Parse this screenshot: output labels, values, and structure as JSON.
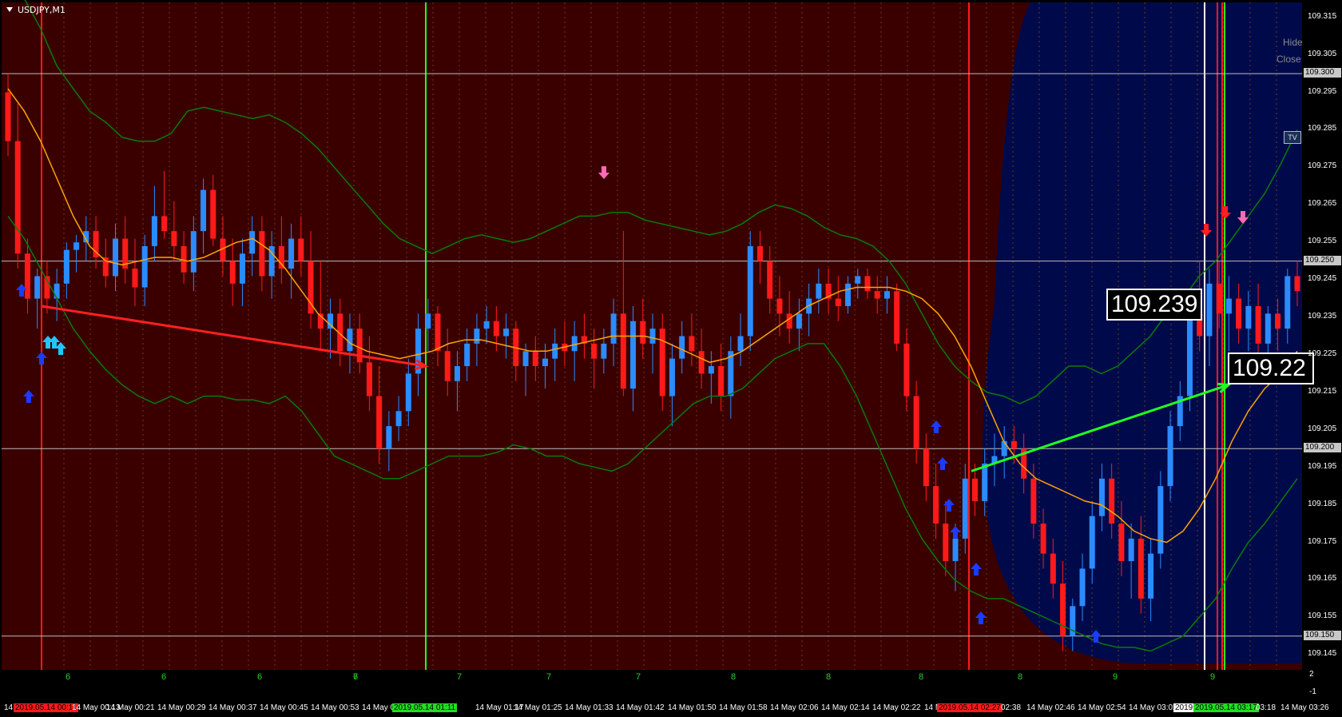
{
  "window": {
    "title": "USDJPY,M1"
  },
  "controls": {
    "hide_label": "Hide",
    "close_label": "Close",
    "tv_label": "TV"
  },
  "colors": {
    "background_red": "#3a0000",
    "background_blue": "#000a4a",
    "bull_candle": "#2a8cff",
    "bear_candle": "#ff1a1a",
    "ma_line": "#ffa500",
    "band_line": "#0a7a0a",
    "arrow_up": "#1a3cff",
    "arrow_up_cyan": "#22c6ff",
    "arrow_down": "#ff6ab4",
    "trend_red": "#ff2020",
    "trend_green": "#22ff22"
  },
  "price_boxes": [
    {
      "name": "price-box-109239",
      "text": "109.239"
    },
    {
      "name": "price-box-10922",
      "text": "109.22"
    }
  ],
  "y_axis": {
    "labels": [
      "109.315",
      "109.305",
      "109.300",
      "109.295",
      "109.285",
      "109.275",
      "109.265",
      "109.255",
      "109.250",
      "109.245",
      "109.235",
      "109.225",
      "109.215",
      "109.205",
      "109.200",
      "109.195",
      "109.185",
      "109.175",
      "109.165",
      "109.155",
      "109.150",
      "109.145"
    ],
    "boxed": [
      "109.300",
      "109.250",
      "109.200",
      "109.150"
    ]
  },
  "x_axis": {
    "labels": [
      {
        "text": "14",
        "style": "plain"
      },
      {
        "text": "2019.05.14 00:11",
        "style": "red"
      },
      {
        "text": "14 May 00:13",
        "style": "plain"
      },
      {
        "text": "14 May 00:21",
        "style": "plain"
      },
      {
        "text": "14 May 00:29",
        "style": "plain"
      },
      {
        "text": "14 May 00:37",
        "style": "plain"
      },
      {
        "text": "14 May 00:45",
        "style": "plain"
      },
      {
        "text": "14 May 00:53",
        "style": "plain"
      },
      {
        "text": "14 May 0",
        "style": "plain"
      },
      {
        "text": "2019.05.14 01:11",
        "style": "green"
      },
      {
        "text": "14 May 01:17",
        "style": "plain"
      },
      {
        "text": "14 May 01:25",
        "style": "plain"
      },
      {
        "text": "14 May 01:33",
        "style": "plain"
      },
      {
        "text": "14 May 01:42",
        "style": "plain"
      },
      {
        "text": "14 May 01:50",
        "style": "plain"
      },
      {
        "text": "14 May 01:58",
        "style": "plain"
      },
      {
        "text": "14 May 02:06",
        "style": "plain"
      },
      {
        "text": "14 May 02:14",
        "style": "plain"
      },
      {
        "text": "14 May 02:22",
        "style": "plain"
      },
      {
        "text": "14 M",
        "style": "plain"
      },
      {
        "text": "2019.05.14 02:27",
        "style": "red"
      },
      {
        "text": "02:38",
        "style": "plain"
      },
      {
        "text": "14 May 02:46",
        "style": "plain"
      },
      {
        "text": "14 May 02:54",
        "style": "plain"
      },
      {
        "text": "14 May 03:02",
        "style": "plain"
      },
      {
        "text": "2019",
        "style": "white"
      },
      {
        "text": "2019.05.14 03:17",
        "style": "green"
      },
      {
        "text": "03:18",
        "style": "plain"
      },
      {
        "text": "14 May 03:26",
        "style": "plain"
      }
    ]
  },
  "bar_numbers": [
    "6",
    "6",
    "6",
    "6",
    "7",
    "7",
    "7",
    "7",
    "8",
    "8",
    "8",
    "8",
    "9",
    "9"
  ],
  "right_markers": [
    "2",
    "-1"
  ],
  "chart_data": {
    "type": "candlestick",
    "title": "USDJPY,M1",
    "ylim": [
      109.141,
      109.319
    ],
    "candles_ohlc": [
      [
        109.295,
        109.3,
        109.278,
        109.282
      ],
      [
        109.282,
        109.292,
        109.248,
        109.252
      ],
      [
        109.252,
        109.256,
        109.236,
        109.24
      ],
      [
        109.24,
        109.248,
        109.232,
        109.246
      ],
      [
        109.246,
        109.25,
        109.236,
        109.24
      ],
      [
        109.24,
        109.248,
        109.234,
        109.244
      ],
      [
        109.244,
        109.255,
        109.24,
        109.253
      ],
      [
        109.253,
        109.257,
        109.247,
        109.255
      ],
      [
        109.255,
        109.262,
        109.25,
        109.258
      ],
      [
        109.258,
        109.262,
        109.248,
        109.251
      ],
      [
        109.251,
        109.256,
        109.243,
        109.246
      ],
      [
        109.246,
        109.26,
        109.242,
        109.256
      ],
      [
        109.256,
        109.262,
        109.244,
        109.248
      ],
      [
        109.248,
        109.256,
        109.238,
        109.243
      ],
      [
        109.243,
        109.257,
        109.238,
        109.254
      ],
      [
        109.254,
        109.27,
        109.25,
        109.262
      ],
      [
        109.262,
        109.274,
        109.256,
        109.258
      ],
      [
        109.258,
        109.266,
        109.25,
        109.254
      ],
      [
        109.254,
        109.258,
        109.244,
        109.247
      ],
      [
        109.247,
        109.262,
        109.242,
        109.258
      ],
      [
        109.258,
        109.272,
        109.252,
        109.269
      ],
      [
        109.269,
        109.273,
        109.254,
        109.256
      ],
      [
        109.256,
        109.262,
        109.246,
        109.25
      ],
      [
        109.25,
        109.256,
        109.238,
        109.244
      ],
      [
        109.244,
        109.256,
        109.238,
        109.252
      ],
      [
        109.252,
        109.262,
        109.246,
        109.258
      ],
      [
        109.258,
        109.262,
        109.242,
        109.246
      ],
      [
        109.246,
        109.258,
        109.24,
        109.254
      ],
      [
        109.254,
        109.262,
        109.244,
        109.248
      ],
      [
        109.248,
        109.26,
        109.24,
        109.256
      ],
      [
        109.256,
        109.262,
        109.246,
        109.25
      ],
      [
        109.25,
        109.258,
        109.232,
        109.236
      ],
      [
        109.236,
        109.25,
        109.226,
        109.232
      ],
      [
        109.232,
        109.24,
        109.224,
        109.236
      ],
      [
        109.236,
        109.24,
        109.222,
        109.226
      ],
      [
        109.226,
        109.236,
        109.22,
        109.232
      ],
      [
        109.232,
        109.236,
        109.22,
        109.223
      ],
      [
        109.223,
        109.23,
        109.21,
        109.214
      ],
      [
        109.214,
        109.222,
        109.196,
        109.2
      ],
      [
        109.2,
        109.21,
        109.194,
        109.206
      ],
      [
        109.206,
        109.214,
        109.202,
        109.21
      ],
      [
        109.21,
        109.224,
        109.206,
        109.22
      ],
      [
        109.22,
        109.236,
        109.214,
        109.232
      ],
      [
        109.232,
        109.24,
        109.226,
        109.236
      ],
      [
        109.236,
        109.238,
        109.222,
        109.226
      ],
      [
        109.226,
        109.232,
        109.214,
        109.218
      ],
      [
        109.218,
        109.226,
        109.21,
        109.222
      ],
      [
        109.222,
        109.232,
        109.218,
        109.228
      ],
      [
        109.228,
        109.236,
        109.222,
        109.232
      ],
      [
        109.232,
        109.238,
        109.228,
        109.234
      ],
      [
        109.234,
        109.238,
        109.226,
        109.23
      ],
      [
        109.23,
        109.236,
        109.224,
        109.232
      ],
      [
        109.232,
        109.234,
        109.218,
        109.222
      ],
      [
        109.222,
        109.228,
        109.214,
        109.226
      ],
      [
        109.226,
        109.23,
        109.218,
        109.222
      ],
      [
        109.222,
        109.228,
        109.216,
        109.224
      ],
      [
        109.224,
        109.232,
        109.218,
        109.228
      ],
      [
        109.228,
        109.234,
        109.222,
        109.226
      ],
      [
        109.226,
        109.234,
        109.218,
        109.23
      ],
      [
        109.23,
        109.236,
        109.224,
        109.228
      ],
      [
        109.228,
        109.232,
        109.216,
        109.224
      ],
      [
        109.224,
        109.232,
        109.22,
        109.228
      ],
      [
        109.228,
        109.24,
        109.222,
        109.236
      ],
      [
        109.236,
        109.258,
        109.214,
        109.216
      ],
      [
        109.216,
        109.238,
        109.21,
        109.234
      ],
      [
        109.234,
        109.24,
        109.224,
        109.228
      ],
      [
        109.228,
        109.236,
        109.22,
        109.232
      ],
      [
        109.232,
        109.236,
        109.21,
        109.214
      ],
      [
        109.214,
        109.228,
        109.206,
        109.224
      ],
      [
        109.224,
        109.234,
        109.22,
        109.23
      ],
      [
        109.23,
        109.236,
        109.222,
        109.226
      ],
      [
        109.226,
        109.232,
        109.216,
        109.22
      ],
      [
        109.22,
        109.226,
        109.212,
        109.222
      ],
      [
        109.222,
        109.228,
        109.21,
        109.214
      ],
      [
        109.214,
        109.23,
        109.208,
        109.226
      ],
      [
        109.226,
        109.236,
        109.222,
        109.23
      ],
      [
        109.23,
        109.258,
        109.226,
        109.254
      ],
      [
        109.254,
        109.258,
        109.244,
        109.25
      ],
      [
        109.25,
        109.254,
        109.236,
        109.24
      ],
      [
        109.24,
        109.246,
        109.23,
        109.236
      ],
      [
        109.236,
        109.242,
        109.228,
        109.232
      ],
      [
        109.232,
        109.24,
        109.226,
        109.236
      ],
      [
        109.236,
        109.244,
        109.23,
        109.24
      ],
      [
        109.24,
        109.248,
        109.236,
        109.244
      ],
      [
        109.244,
        109.248,
        109.236,
        109.24
      ],
      [
        109.24,
        109.246,
        109.234,
        109.238
      ],
      [
        109.238,
        109.246,
        109.236,
        109.244
      ],
      [
        109.244,
        109.248,
        109.24,
        109.246
      ],
      [
        109.246,
        109.248,
        109.24,
        109.242
      ],
      [
        109.242,
        109.246,
        109.236,
        109.24
      ],
      [
        109.24,
        109.246,
        109.236,
        109.242
      ],
      [
        109.242,
        109.244,
        109.226,
        109.228
      ],
      [
        109.228,
        109.232,
        109.21,
        109.214
      ],
      [
        109.214,
        109.218,
        109.196,
        109.2
      ],
      [
        109.2,
        109.204,
        109.186,
        109.19
      ],
      [
        109.19,
        109.196,
        109.176,
        109.18
      ],
      [
        109.18,
        109.186,
        109.166,
        109.17
      ],
      [
        109.17,
        109.18,
        109.162,
        109.176
      ],
      [
        109.176,
        109.196,
        109.172,
        109.192
      ],
      [
        109.192,
        109.196,
        109.182,
        109.186
      ],
      [
        109.186,
        109.2,
        109.182,
        109.196
      ],
      [
        109.196,
        109.204,
        109.19,
        109.198
      ],
      [
        109.198,
        109.206,
        109.192,
        109.202
      ],
      [
        109.202,
        109.206,
        109.196,
        109.2
      ],
      [
        109.2,
        109.204,
        109.188,
        109.192
      ],
      [
        109.192,
        109.196,
        109.176,
        109.18
      ],
      [
        109.18,
        109.184,
        109.168,
        109.172
      ],
      [
        109.172,
        109.176,
        109.16,
        109.164
      ],
      [
        109.164,
        109.17,
        109.146,
        109.15
      ],
      [
        109.15,
        109.16,
        109.146,
        109.158
      ],
      [
        109.158,
        109.172,
        109.154,
        109.168
      ],
      [
        109.168,
        109.186,
        109.164,
        109.182
      ],
      [
        109.182,
        109.196,
        109.178,
        109.192
      ],
      [
        109.192,
        109.196,
        109.176,
        109.18
      ],
      [
        109.18,
        109.186,
        109.166,
        109.17
      ],
      [
        109.17,
        109.18,
        109.16,
        109.176
      ],
      [
        109.176,
        109.182,
        109.156,
        109.16
      ],
      [
        109.16,
        109.176,
        109.154,
        109.172
      ],
      [
        109.172,
        109.194,
        109.168,
        109.19
      ],
      [
        109.19,
        109.21,
        109.186,
        109.206
      ],
      [
        109.206,
        109.218,
        109.202,
        109.214
      ],
      [
        109.214,
        109.238,
        109.21,
        109.236
      ],
      [
        109.236,
        109.25,
        109.226,
        109.23
      ],
      [
        109.23,
        109.248,
        109.222,
        109.244
      ],
      [
        109.244,
        109.25,
        109.232,
        109.236
      ],
      [
        109.236,
        109.246,
        109.226,
        109.24
      ],
      [
        109.24,
        109.244,
        109.228,
        109.232
      ],
      [
        109.232,
        109.242,
        109.226,
        109.238
      ],
      [
        109.238,
        109.244,
        109.224,
        109.228
      ],
      [
        109.228,
        109.238,
        109.222,
        109.236
      ],
      [
        109.236,
        109.24,
        109.226,
        109.232
      ],
      [
        109.232,
        109.248,
        109.228,
        109.246
      ],
      [
        109.246,
        109.25,
        109.238,
        109.242
      ]
    ],
    "ma": [
      109.296,
      109.29,
      109.282,
      109.272,
      109.262,
      109.254,
      109.25,
      109.249,
      109.25,
      109.251,
      109.251,
      109.25,
      109.251,
      109.253,
      109.255,
      109.256,
      109.253,
      109.248,
      109.242,
      109.236,
      109.232,
      109.228,
      109.226,
      109.225,
      109.224,
      109.225,
      109.226,
      109.228,
      109.229,
      109.229,
      109.228,
      109.227,
      109.226,
      109.226,
      109.227,
      109.228,
      109.229,
      109.23,
      109.23,
      109.23,
      109.229,
      109.227,
      109.225,
      109.223,
      109.224,
      109.226,
      109.229,
      109.232,
      109.235,
      109.238,
      109.24,
      109.242,
      109.243,
      109.243,
      109.243,
      109.242,
      109.24,
      109.236,
      109.23,
      109.222,
      109.212,
      109.202,
      109.196,
      109.192,
      109.19,
      109.188,
      109.186,
      109.185,
      109.182,
      109.178,
      109.176,
      109.175,
      109.178,
      109.184,
      109.192,
      109.202,
      109.21,
      109.216,
      109.22,
      109.226
    ],
    "upper_band": [
      109.325,
      109.32,
      109.312,
      109.302,
      109.296,
      109.29,
      109.287,
      109.283,
      109.282,
      109.282,
      109.284,
      109.29,
      109.291,
      109.29,
      109.289,
      109.288,
      109.289,
      109.287,
      109.284,
      109.28,
      109.275,
      109.27,
      109.265,
      109.26,
      109.256,
      109.254,
      109.252,
      109.254,
      109.256,
      109.257,
      109.256,
      109.255,
      109.256,
      109.258,
      109.26,
      109.262,
      109.262,
      109.263,
      109.263,
      109.261,
      109.26,
      109.259,
      109.258,
      109.257,
      109.258,
      109.26,
      109.263,
      109.265,
      109.264,
      109.262,
      109.259,
      109.257,
      109.256,
      109.254,
      109.25,
      109.244,
      109.236,
      109.228,
      109.222,
      109.218,
      109.215,
      109.214,
      109.212,
      109.214,
      109.218,
      109.222,
      109.222,
      109.22,
      109.222,
      109.226,
      109.23,
      109.236,
      109.24,
      109.246,
      109.25,
      109.256,
      109.262,
      109.268,
      109.276,
      109.285
    ],
    "lower_band": [
      109.262,
      109.256,
      109.248,
      109.24,
      109.232,
      109.226,
      109.221,
      109.217,
      109.214,
      109.212,
      109.214,
      109.212,
      109.214,
      109.214,
      109.213,
      109.213,
      109.212,
      109.214,
      109.21,
      109.204,
      109.198,
      109.196,
      109.194,
      109.192,
      109.192,
      109.194,
      109.196,
      109.198,
      109.198,
      109.198,
      109.199,
      109.201,
      109.2,
      109.198,
      109.198,
      109.196,
      109.195,
      109.194,
      109.196,
      109.2,
      109.204,
      109.208,
      109.212,
      109.214,
      109.214,
      109.216,
      109.22,
      109.224,
      109.226,
      109.228,
      109.228,
      109.222,
      109.214,
      109.204,
      109.194,
      109.184,
      109.176,
      109.17,
      109.165,
      109.162,
      109.16,
      109.16,
      109.158,
      109.156,
      109.154,
      109.152,
      109.15,
      109.148,
      109.147,
      109.147,
      109.146,
      109.148,
      109.15,
      109.155,
      109.16,
      109.168,
      109.175,
      109.18,
      109.186,
      109.192
    ],
    "red_trend": [
      [
        109.238,
        109.222
      ]
    ],
    "green_trend": [
      [
        109.194,
        109.217
      ]
    ],
    "horizontal_levels": [
      109.3,
      109.25,
      109.2,
      109.15
    ]
  }
}
